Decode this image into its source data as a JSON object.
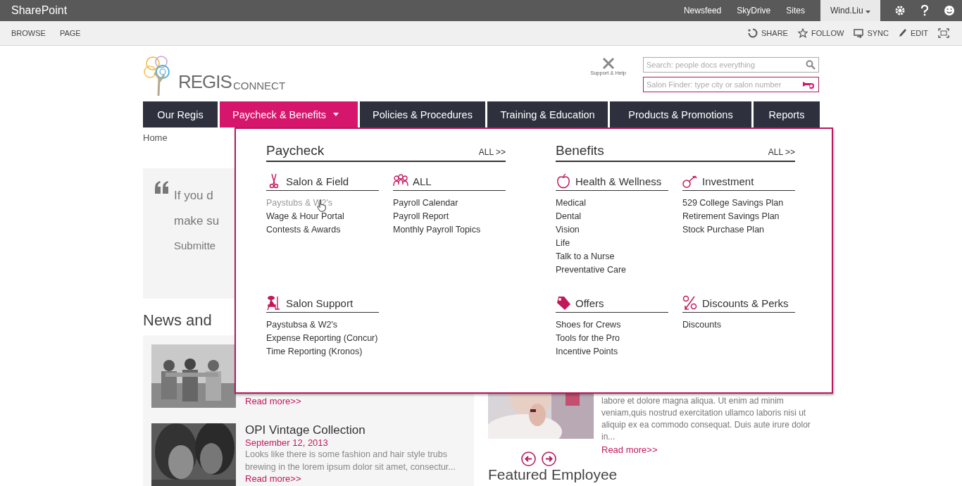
{
  "top_bar": {
    "title": "SharePoint",
    "links": [
      "Newsfeed",
      "SkyDrive",
      "Sites"
    ],
    "user": "Wind.Liu"
  },
  "ribbon": {
    "tabs": [
      "BROWSE",
      "PAGE"
    ],
    "actions": [
      "SHARE",
      "FOLLOW",
      "SYNC",
      "EDIT"
    ]
  },
  "header": {
    "logo": {
      "name": "REGIS",
      "suffix": "CONNECT"
    },
    "support": "Support & Help",
    "search": {
      "placeholder": "Search: people docs everything"
    },
    "salon_finder": {
      "placeholder": "Salon Finder: type city or salon number"
    }
  },
  "nav": [
    {
      "label": "Our Regis",
      "selected": false,
      "has_menu": false
    },
    {
      "label": "Paycheck & Benefits",
      "selected": true,
      "has_menu": true
    },
    {
      "label": "Policies & Procedures",
      "selected": false,
      "has_menu": false
    },
    {
      "label": "Training & Education",
      "selected": false,
      "has_menu": false
    },
    {
      "label": "Products & Promotions",
      "selected": false,
      "has_menu": false
    },
    {
      "label": "Reports",
      "selected": false,
      "has_menu": false
    }
  ],
  "breadcrumb": "Home",
  "quote": {
    "lines": [
      "If you d",
      "make su"
    ],
    "submitted": "Submitte"
  },
  "news": {
    "heading": "News and",
    "items": [
      {
        "read_more": "Read more>>"
      },
      {
        "title": "OPI Vintage Collection",
        "date": "September 12, 2013",
        "text": "Looks like there is some fashion and hair style trubs brewing in the lorem ipsum dolor sit amet, consectur...",
        "read_more": "Read more>>"
      }
    ]
  },
  "feature": {
    "text": "labore et dolore magna aliqua. Ut enim ad minim veniam,quis nostrud exercitation ullamco laboris nisi ut aliquip ex ea commodo consequat. Duis aute irure dolor in...",
    "read_more": "Read more>>"
  },
  "featured_heading": "Featured Employee",
  "mega_menu": {
    "sections": [
      {
        "title": "Paycheck",
        "all": "ALL >>",
        "groups": [
          {
            "title": "Salon & Field",
            "links": [
              {
                "label": "Paystubs & W2's",
                "hovered": true
              },
              {
                "label": "Wage & Hour Portal",
                "hovered": false
              },
              {
                "label": "Contests & Awards",
                "hovered": false
              }
            ]
          },
          {
            "title": "ALL",
            "links": [
              {
                "label": "Payroll Calendar",
                "hovered": false
              },
              {
                "label": "Payroll Report",
                "hovered": false
              },
              {
                "label": "Monthly Payroll Topics",
                "hovered": false
              }
            ]
          },
          {
            "title": "Salon Support",
            "links": [
              {
                "label": "Paystubsa & W2's",
                "hovered": false
              },
              {
                "label": "Expense Reporting (Concur)",
                "hovered": false
              },
              {
                "label": "Time Reporting (Kronos)",
                "hovered": false
              }
            ]
          }
        ]
      },
      {
        "title": "Benefits",
        "all": "ALL >>",
        "groups": [
          {
            "title": "Health & Wellness",
            "links": [
              {
                "label": "Medical",
                "hovered": false
              },
              {
                "label": "Dental",
                "hovered": false
              },
              {
                "label": "Vision",
                "hovered": false
              },
              {
                "label": "Life",
                "hovered": false
              },
              {
                "label": "Talk to a Nurse",
                "hovered": false
              },
              {
                "label": "Preventative Care",
                "hovered": false
              }
            ]
          },
          {
            "title": "Investment",
            "links": [
              {
                "label": "529 College Savings Plan",
                "hovered": false
              },
              {
                "label": "Retirement Savings Plan",
                "hovered": false
              },
              {
                "label": "Stock Purchase Plan",
                "hovered": false
              }
            ]
          },
          {
            "title": "Offers",
            "links": [
              {
                "label": "Shoes for Crews",
                "hovered": false
              },
              {
                "label": "Tools for the Pro",
                "hovered": false
              },
              {
                "label": "Incentive Points",
                "hovered": false
              }
            ]
          },
          {
            "title": "Discounts & Perks",
            "links": [
              {
                "label": "Discounts",
                "hovered": false
              }
            ]
          }
        ]
      }
    ]
  }
}
